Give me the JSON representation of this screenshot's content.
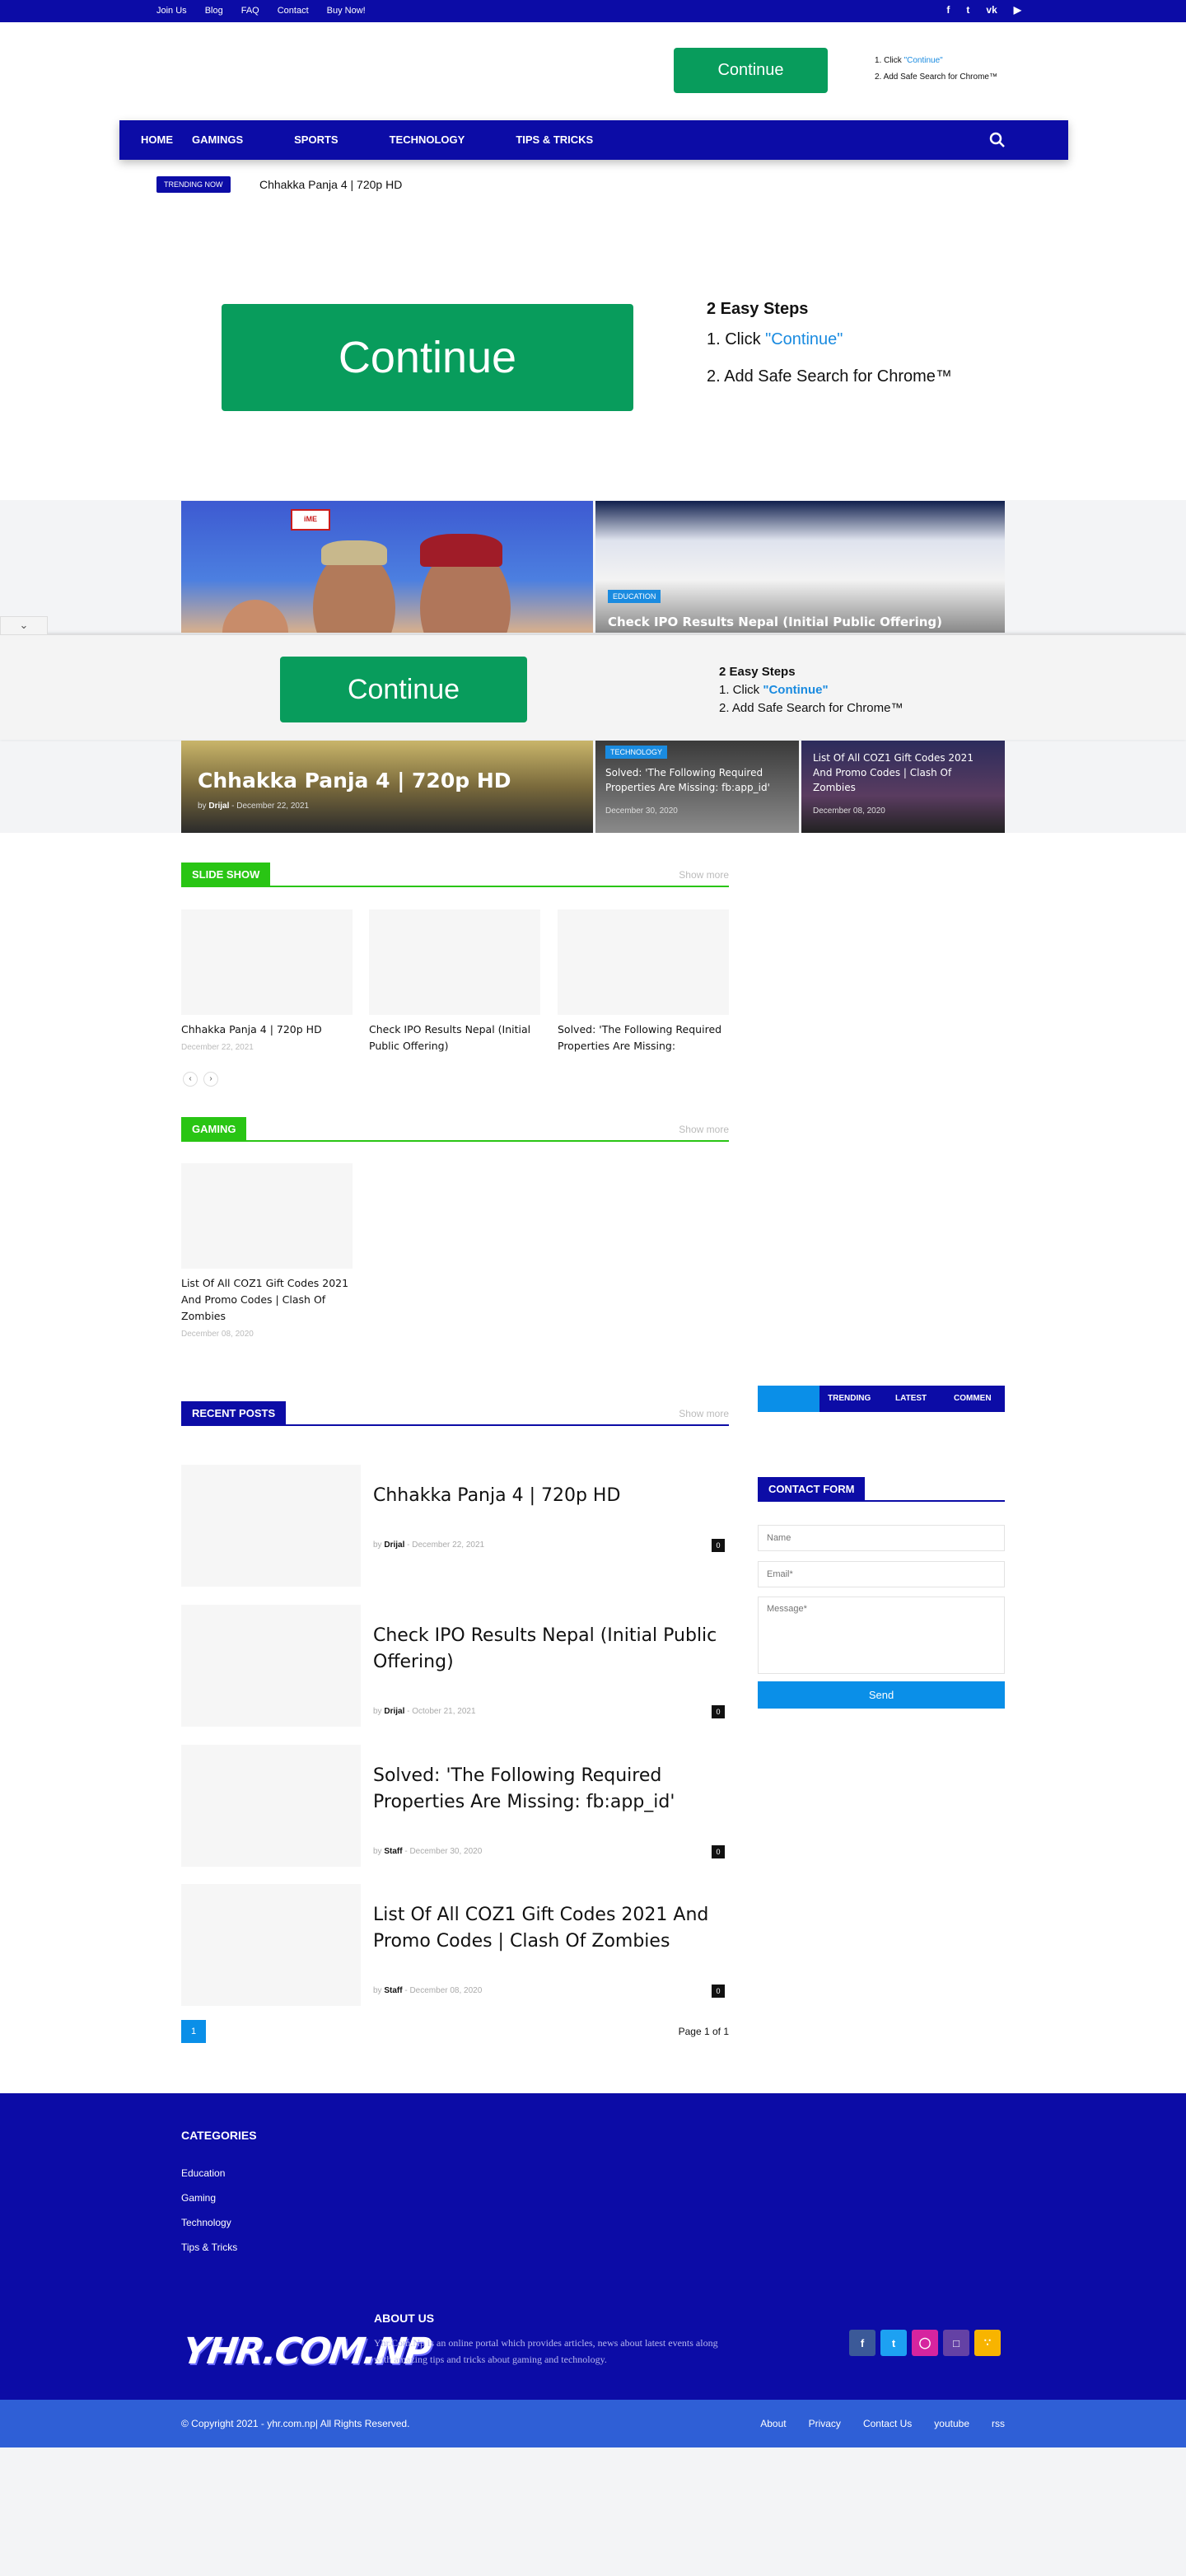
{
  "topbar": {
    "links": [
      "Join Us",
      "Blog",
      "FAQ",
      "Contact",
      "Buy Now!"
    ],
    "social_icons": [
      "facebook-icon",
      "twitter-icon",
      "vk-icon",
      "youtube-icon"
    ]
  },
  "header_ad": {
    "button": "Continue",
    "step1_prefix": "1. Click ",
    "step1_link": "\"Continue\"",
    "step2": "2. Add Safe Search for Chrome™"
  },
  "nav": {
    "items": [
      "HOME",
      "GAMINGS",
      "SPORTS",
      "TECHNOLOGY",
      "TIPS & TRICKS"
    ]
  },
  "trending": {
    "label": "TRENDING NOW",
    "text": "Chhakka Panja 4 | 720p HD"
  },
  "big_ad": {
    "button": "Continue",
    "title": "2 Easy Steps",
    "step1_prefix": "1. Click ",
    "step1_link": "\"Continue\"",
    "step2": "2. Add Safe Search for Chrome™"
  },
  "featured": {
    "top_right_tag": "EDUCATION",
    "top_right_title": "Check IPO Results Nepal (Initial Public Offering)",
    "main_title": "Chhakka Panja 4 | 720p HD",
    "main_by": "by ",
    "main_author": "Drijal",
    "main_date": " - December 22, 2021",
    "mid_tag": "TECHNOLOGY",
    "mid_title": "Solved: 'The Following Required Properties Are Missing: fb:app_id'",
    "mid_date": "December 30, 2020",
    "small_title": "List Of All COZ1 Gift Codes 2021 And Promo Codes | Clash Of Zombies",
    "small_date": "December 08, 2020"
  },
  "sticky_ad": {
    "button": "Continue",
    "title": "2 Easy Steps",
    "step1_prefix": "1. Click ",
    "step1_link": "\"Continue\"",
    "step2": "2. Add Safe Search for Chrome™"
  },
  "slideshow": {
    "label": "SLIDE SHOW",
    "more": "Show more",
    "cards": [
      {
        "title": "Chhakka Panja 4 | 720p HD",
        "date": "December 22, 2021"
      },
      {
        "title": "Check IPO Results Nepal (Initial Public Offering)",
        "date": ""
      },
      {
        "title": "Solved: 'The Following Required Properties Are Missing:",
        "date": ""
      }
    ]
  },
  "gaming": {
    "label": "GAMING",
    "more": "Show more",
    "card_title": "List Of All COZ1 Gift Codes 2021 And Promo Codes | Clash Of Zombies",
    "card_date": "December 08, 2020"
  },
  "recent": {
    "label": "RECENT POSTS",
    "more": "Show more",
    "posts": [
      {
        "title": "Chhakka Panja 4 | 720p HD",
        "author": "Drijal",
        "date": " - December 22, 2021",
        "count": "0"
      },
      {
        "title": "Check IPO Results Nepal (Initial Public Offering)",
        "author": "Drijal",
        "date": " - October 21, 2021",
        "count": "0"
      },
      {
        "title": "Solved: 'The Following Required Properties Are Missing: fb:app_id'",
        "author": "Staff",
        "date": " - December 30, 2020",
        "count": "0"
      },
      {
        "title": "List Of All COZ1 Gift Codes 2021 And Promo Codes | Clash Of Zombies",
        "author": "Staff",
        "date": " - December 08, 2020",
        "count": "0"
      }
    ],
    "by": "by ",
    "page_num": "1",
    "page_label": "Page 1 of 1"
  },
  "sidebar": {
    "tabs": [
      "TRENDING",
      "LATEST",
      "COMMEN"
    ],
    "contact_label": "CONTACT FORM",
    "name_placeholder": "Name",
    "email_placeholder": "Email*",
    "message_placeholder": "Message*",
    "send": "Send"
  },
  "footer": {
    "categories_title": "CATEGORIES",
    "categories": [
      "Education",
      "Gaming",
      "Technology",
      "Tips & Tricks"
    ],
    "logo": "YHR.COM.NP",
    "about_title": "ABOUT US",
    "about_text": "Yhr.Com.Np is an online portal which provides articles, news about latest events along with amazing tips and tricks about gaming and technology.",
    "copyright": "© Copyright 2021 - yhr.com.np| All Rights Reserved.",
    "bottom_links": [
      "About",
      "Privacy",
      "Contact Us",
      "youtube",
      "rss"
    ]
  },
  "colors": {
    "brand_blue": "#0c0ca6",
    "green": "#089c5c",
    "section_green": "#29c514",
    "link_blue": "#1a8be0",
    "send_blue": "#0a8fe8"
  }
}
